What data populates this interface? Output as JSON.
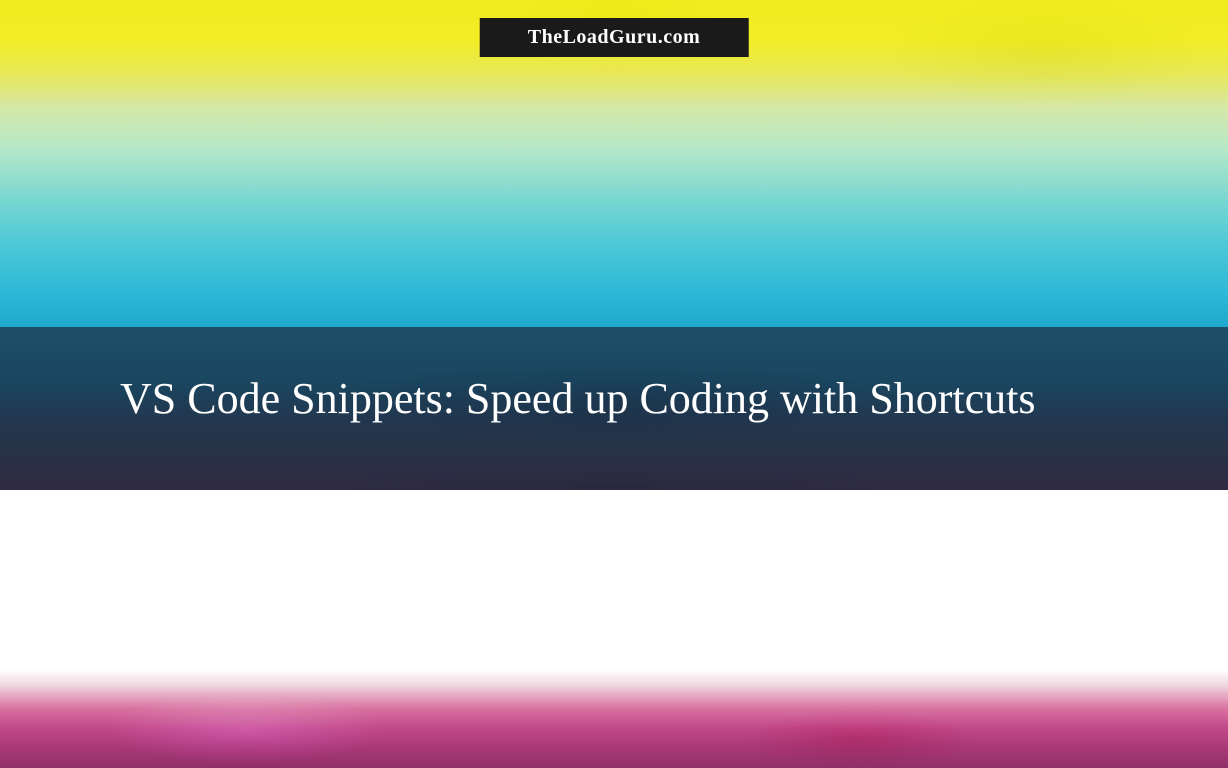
{
  "brand": {
    "name": "TheLoadGuru.com"
  },
  "article": {
    "title": "VS Code Snippets: Speed up Coding with Shortcuts"
  }
}
